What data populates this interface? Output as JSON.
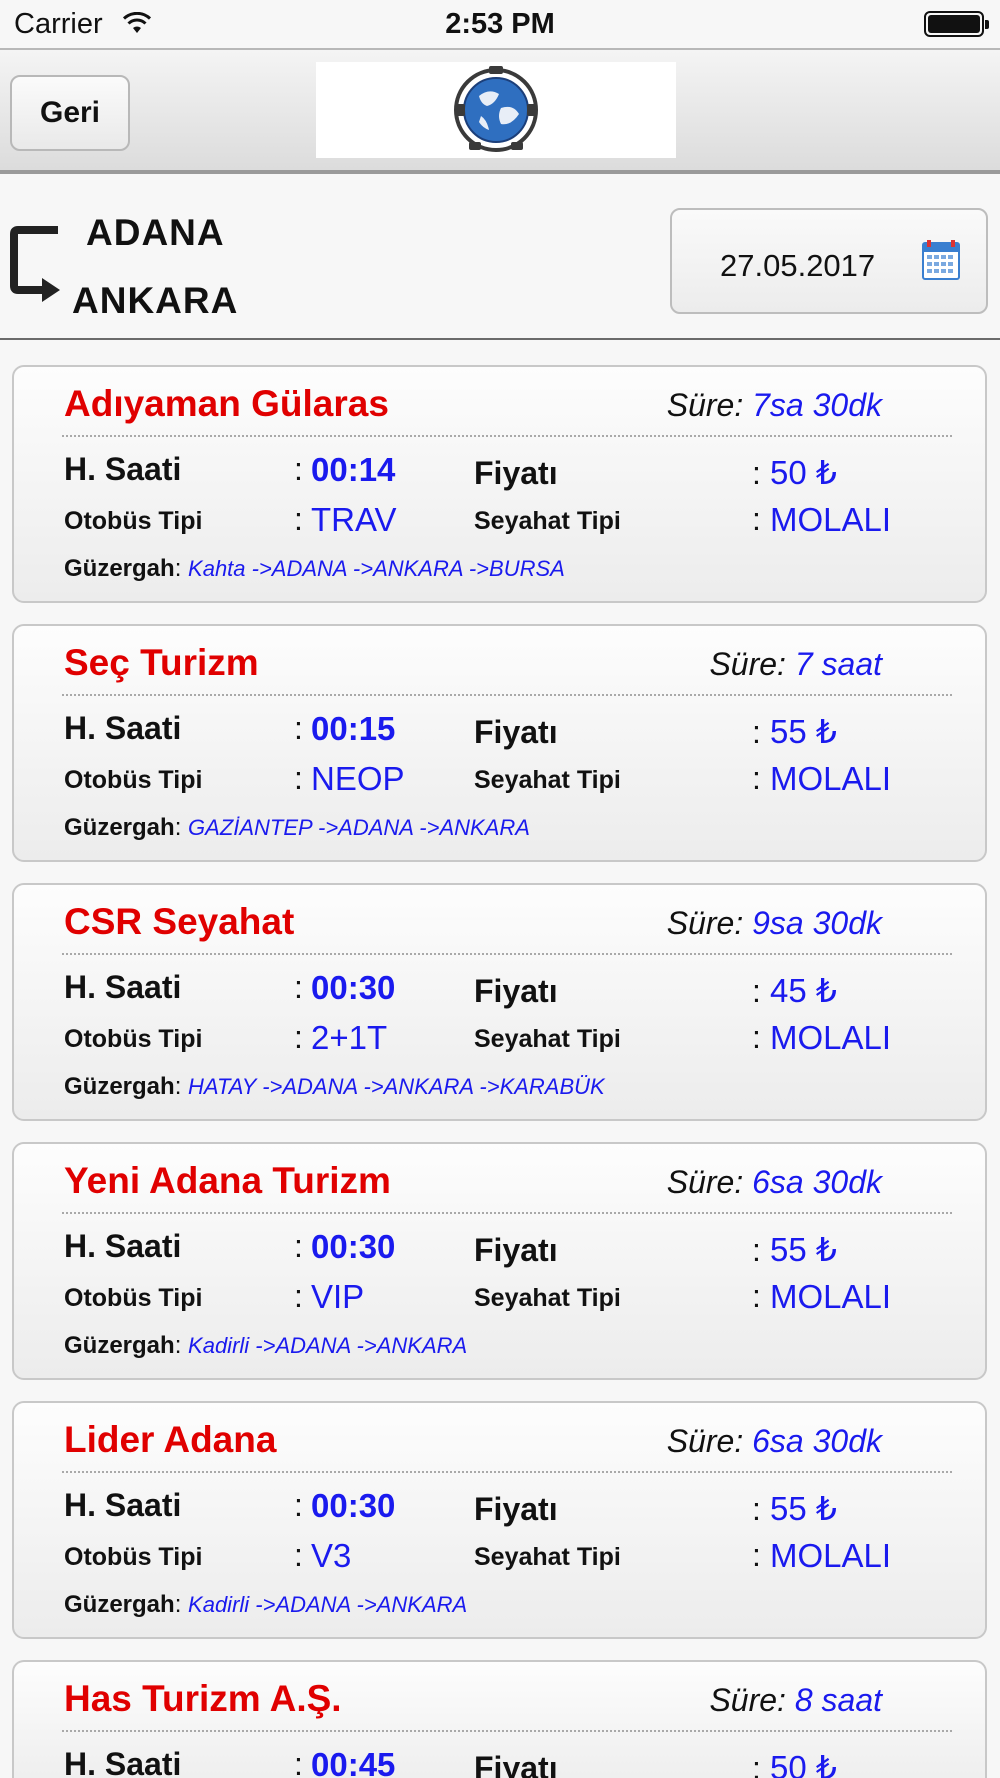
{
  "status_bar": {
    "carrier": "Carrier",
    "time": "2:53 PM"
  },
  "nav": {
    "back_label": "Geri",
    "logo_icon": "globe-logo-icon"
  },
  "route": {
    "from": "ADANA",
    "to": "ANKARA",
    "date": "27.05.2017"
  },
  "labels": {
    "duration": "Süre:",
    "departure": "H. Saati",
    "price": "Fiyatı",
    "bus_type": "Otobüs Tipi",
    "travel_type": "Seyahat Tipi",
    "route": "Güzergah",
    "colon": ":"
  },
  "trips": [
    {
      "company": "Adıyaman Gülaras",
      "duration": "7sa 30dk",
      "time": "00:14",
      "price": "50 ₺",
      "bus_type": "TRAV",
      "travel_type": "MOLALI",
      "route": "Kahta ->ADANA ->ANKARA ->BURSA"
    },
    {
      "company": "Seç Turizm",
      "duration": "7 saat",
      "time": "00:15",
      "price": "55 ₺",
      "bus_type": "NEOP",
      "travel_type": "MOLALI",
      "route": "GAZİANTEP ->ADANA ->ANKARA"
    },
    {
      "company": "CSR Seyahat",
      "duration": "9sa 30dk",
      "time": "00:30",
      "price": "45 ₺",
      "bus_type": "2+1T",
      "travel_type": "MOLALI",
      "route": "HATAY ->ADANA ->ANKARA ->KARABÜK"
    },
    {
      "company": "Yeni Adana Turizm",
      "duration": "6sa 30dk",
      "time": "00:30",
      "price": "55 ₺",
      "bus_type": "VIP",
      "travel_type": "MOLALI",
      "route": "Kadirli ->ADANA ->ANKARA"
    },
    {
      "company": "Lider Adana",
      "duration": "6sa 30dk",
      "time": "00:30",
      "price": "55 ₺",
      "bus_type": "V3",
      "travel_type": "MOLALI",
      "route": "Kadirli ->ADANA ->ANKARA"
    },
    {
      "company": "Has Turizm A.Ş.",
      "duration": "8 saat",
      "time": "00:45",
      "price": "50 ₺",
      "bus_type": "",
      "travel_type": "",
      "route": ""
    }
  ]
}
